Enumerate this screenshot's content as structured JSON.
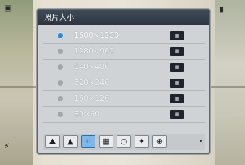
{
  "menu": {
    "title": "照片大小",
    "options": [
      {
        "label": "1600×1200",
        "selected": true
      },
      {
        "label": "1280×960",
        "selected": false
      },
      {
        "label": "640×480",
        "selected": false
      },
      {
        "label": "320×240",
        "selected": false
      },
      {
        "label": "160×120",
        "selected": false
      },
      {
        "label": "80×60",
        "selected": false
      }
    ]
  },
  "toolbar": {
    "items": [
      {
        "name": "scene-icon"
      },
      {
        "name": "landscape-icon"
      },
      {
        "name": "photo-size-icon"
      },
      {
        "name": "quality-icon"
      },
      {
        "name": "timer-icon"
      },
      {
        "name": "effect-icon"
      },
      {
        "name": "zoom-icon"
      }
    ],
    "selected_index": 2
  },
  "colors": {
    "accent": "#3a86d6",
    "title_bar": "#2c3540"
  }
}
